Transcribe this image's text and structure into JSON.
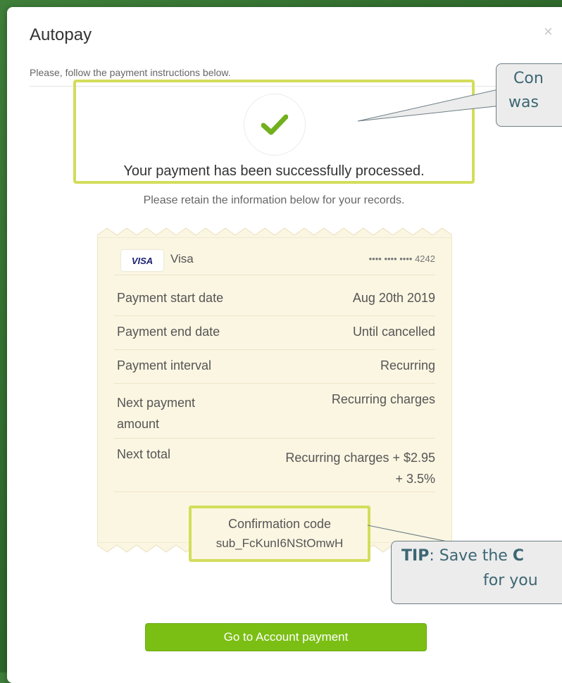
{
  "modal": {
    "title": "Autopay",
    "close_glyph": "×",
    "subtitle": "Please, follow the payment instructions below.",
    "success_icon": "checkmark-icon",
    "success_message": "Your payment has been successfully processed.",
    "retain_message": "Please retain the information below for your records."
  },
  "card": {
    "brand_badge": "VISA",
    "brand_name": "Visa",
    "masked_number": "•••• •••• •••• 4242"
  },
  "details": [
    {
      "key": "Payment start date",
      "value": "Aug 20th 2019"
    },
    {
      "key": "Payment end date",
      "value": "Until cancelled"
    },
    {
      "key": "Payment interval",
      "value": "Recurring"
    },
    {
      "key": "Next payment amount",
      "value": "Recurring charges"
    },
    {
      "key": "Next total",
      "value": "Recurring charges + $2.95 + 3.5%"
    }
  ],
  "confirmation": {
    "label": "Confirmation code",
    "code": "sub_FcKunI6NStOmwH"
  },
  "actions": {
    "go_to_account_payment": "Go to Account payment"
  },
  "callouts": {
    "top_line1": "Con",
    "top_line2": "was",
    "tip_bold1": "TIP",
    "tip_text1": ": Save the ",
    "tip_bold2": "C",
    "tip_line2": "for you"
  },
  "colors": {
    "accent_green": "#7bbf14",
    "highlight_yellow": "#d3dd5c",
    "receipt_bg": "#fbf6e2",
    "callout_text": "#3c6673"
  }
}
